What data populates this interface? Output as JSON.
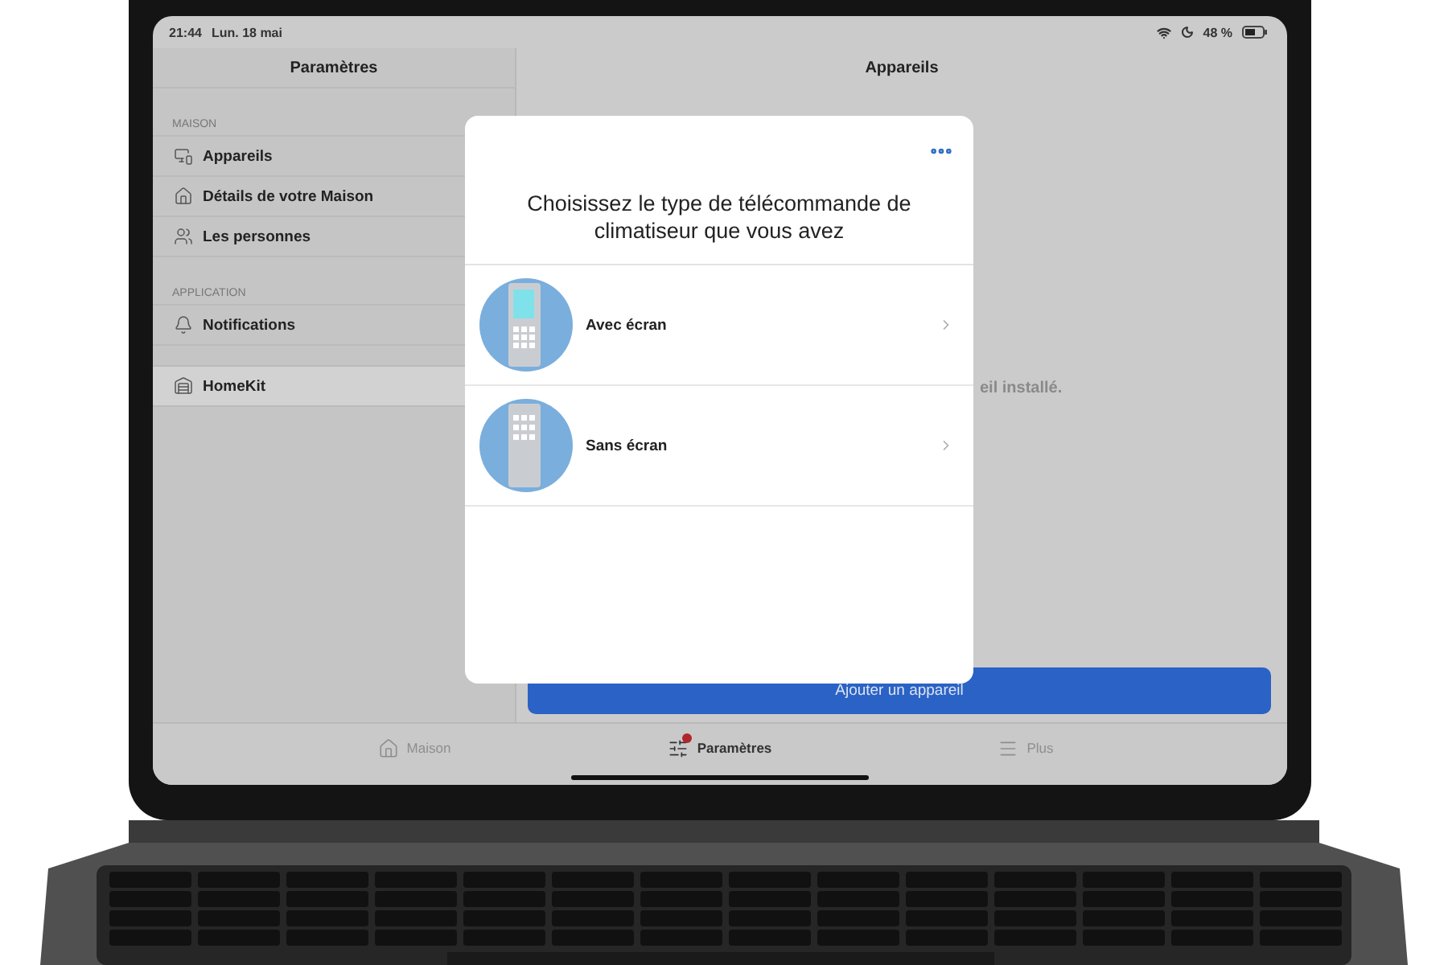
{
  "status_bar": {
    "time": "21:44",
    "date": "Lun. 18 mai",
    "battery": "48 %"
  },
  "sidebar": {
    "title": "Paramètres",
    "sections": [
      {
        "label": "MAISON",
        "items": [
          {
            "label": "Appareils",
            "selected": false
          },
          {
            "label": "Détails de votre Maison",
            "selected": false
          },
          {
            "label": "Les personnes",
            "selected": false
          }
        ]
      },
      {
        "label": "APPLICATION",
        "items": [
          {
            "label": "Notifications",
            "selected": false
          }
        ]
      },
      {
        "items": [
          {
            "label": "HomeKit",
            "selected": true
          }
        ]
      }
    ]
  },
  "main": {
    "title": "Appareils",
    "message": "eil installé.",
    "add_button": "Ajouter un appareil"
  },
  "dialog": {
    "title": "Choisissez le type de télécommande de climatiseur que vous avez",
    "options": [
      {
        "label": "Avec écran",
        "kind": "screen"
      },
      {
        "label": "Sans écran",
        "kind": "buttons"
      }
    ]
  },
  "tab_bar": [
    {
      "label": "Maison",
      "selected": false,
      "badge": false
    },
    {
      "label": "Paramètres",
      "selected": true,
      "badge": true
    },
    {
      "label": "Plus",
      "selected": false,
      "badge": false
    }
  ]
}
